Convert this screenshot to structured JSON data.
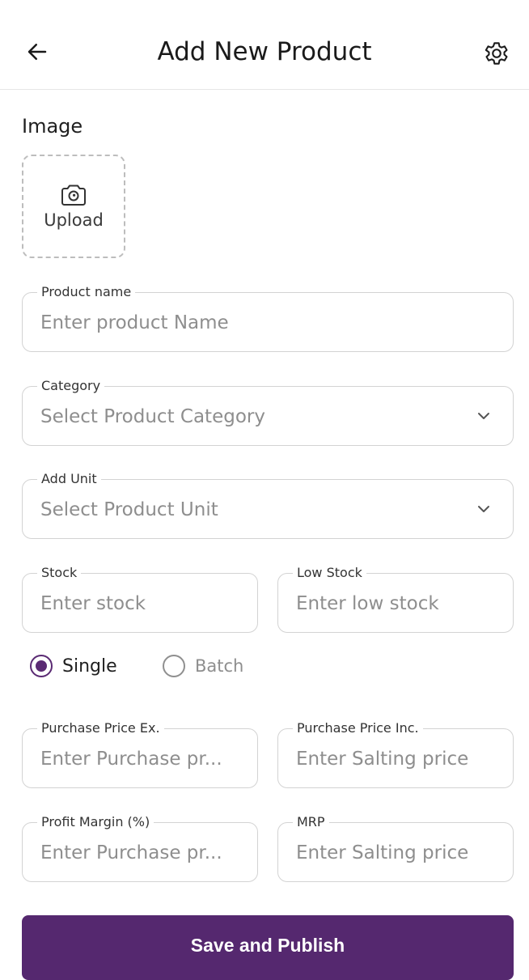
{
  "header": {
    "title": "Add New Product"
  },
  "image_section": {
    "label": "Image",
    "upload_label": "Upload"
  },
  "fields": {
    "product_name": {
      "label": "Product name",
      "placeholder": "Enter product Name"
    },
    "category": {
      "label": "Category",
      "placeholder": "Select Product Category"
    },
    "unit": {
      "label": "Add Unit",
      "placeholder": "Select Product Unit"
    },
    "stock": {
      "label": "Stock",
      "placeholder": "Enter stock"
    },
    "low_stock": {
      "label": "Low Stock",
      "placeholder": "Enter low stock"
    },
    "purchase_price_ex": {
      "label": "Purchase Price Ex.",
      "placeholder": "Enter Purchase pr..."
    },
    "purchase_price_inc": {
      "label": "Purchase Price Inc.",
      "placeholder": "Enter Salting price"
    },
    "profit_margin": {
      "label": "Profit Margin (%)",
      "placeholder": "Enter Purchase pr..."
    },
    "mrp": {
      "label": "MRP",
      "placeholder": "Enter Salting price"
    }
  },
  "stock_type": {
    "options": [
      {
        "label": "Single",
        "selected": true
      },
      {
        "label": "Batch",
        "selected": false
      }
    ]
  },
  "actions": {
    "save_label": "Save and Publish"
  },
  "icons": {
    "back": "arrow-left-icon",
    "settings": "gear-icon",
    "upload": "camera-icon",
    "dropdown": "chevron-down-icon"
  },
  "colors": {
    "primary": "#55286f",
    "border": "#d3d3d3",
    "placeholder": "#8e8e8e"
  }
}
